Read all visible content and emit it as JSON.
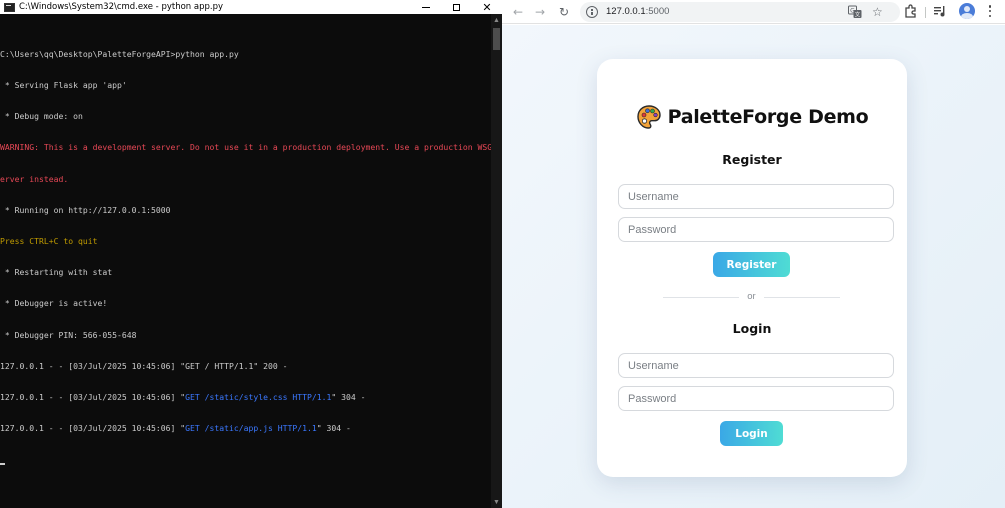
{
  "cmd": {
    "title": "C:\\Windows\\System32\\cmd.exe - python  app.py",
    "lines": [
      {
        "text": "C:\\Users\\qq\\Desktop\\PaletteForgeAPI>python app.py",
        "style": "normal"
      },
      {
        "text": " * Serving Flask app 'app'",
        "style": "normal"
      },
      {
        "text": " * Debug mode: on",
        "style": "normal"
      },
      {
        "text": "WARNING: This is a development server. Do not use it in a production deployment. Use a production WSGI s",
        "style": "warn"
      },
      {
        "text": "erver instead.",
        "style": "warn"
      },
      {
        "text": " * Running on http://127.0.0.1:5000",
        "style": "normal"
      },
      {
        "text": "Press CTRL+C to quit",
        "style": "yellow"
      },
      {
        "text": " * Restarting with stat",
        "style": "normal"
      },
      {
        "text": " * Debugger is active!",
        "style": "normal"
      },
      {
        "text": " * Debugger PIN: 566-055-648",
        "style": "normal"
      },
      {
        "text": "127.0.0.1 - - [03/Jul/2025 10:45:06] \"GET / HTTP/1.1\" 200 -",
        "style": "normal"
      },
      {
        "prefix": "127.0.0.1 - - [03/Jul/2025 10:45:06] \"",
        "highlight": "GET /static/style.css HTTP/1.1",
        "suffix": "\" 304 -",
        "style": "request"
      },
      {
        "prefix": "127.0.0.1 - - [03/Jul/2025 10:45:06] \"",
        "highlight": "GET /static/app.js HTTP/1.1",
        "suffix": "\" 304 -",
        "style": "request"
      }
    ]
  },
  "browser": {
    "url_host": "127.0.0.1",
    "url_port": ":5000"
  },
  "page": {
    "app_title": "PaletteForge Demo",
    "register": {
      "heading": "Register",
      "username_placeholder": "Username",
      "password_placeholder": "Password",
      "button_label": "Register"
    },
    "divider_text": "or",
    "login": {
      "heading": "Login",
      "username_placeholder": "Username",
      "password_placeholder": "Password",
      "button_label": "Login"
    }
  },
  "colors": {
    "console_text": "#cccccc",
    "console_warning": "#e74856",
    "console_yellow": "#c19c00",
    "console_link": "#3b78ff",
    "button_gradient_start": "#3aa8e6",
    "button_gradient_end": "#4fdcd4"
  },
  "icons": [
    "console-app-icon",
    "back-arrow-icon",
    "forward-arrow-icon",
    "reload-icon",
    "site-info-icon",
    "translate-icon",
    "star-icon",
    "extensions-icon",
    "media-controls-icon",
    "profile-avatar-icon",
    "more-menu-icon",
    "palette-icon"
  ]
}
